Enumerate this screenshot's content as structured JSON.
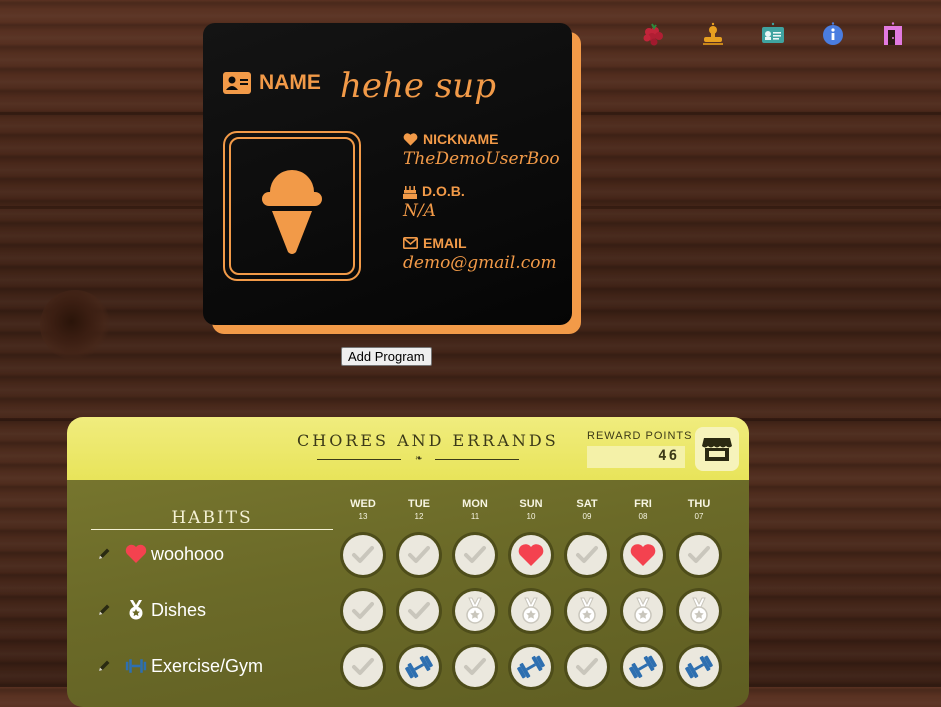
{
  "toolbar": {
    "icons": [
      "raspberry-icon",
      "stamp-icon",
      "id-card-icon",
      "info-icon",
      "exit-door-icon"
    ],
    "colors": [
      "#c2243a",
      "#e8a020",
      "#3fa3a0",
      "#4a7de0",
      "#e27ae0"
    ]
  },
  "profile": {
    "name_label": "NAME",
    "name_value": "hehe sup",
    "nickname_label": "NICKNAME",
    "nickname_value": "TheDemoUserBoo",
    "dob_label": "D.O.B.",
    "dob_value": "N/A",
    "email_label": "EMAIL",
    "email_value": "demo@gmail.com",
    "accent_color": "#f29a48"
  },
  "add_program_label": "Add Program",
  "chores": {
    "title": "CHORES AND ERRANDS",
    "reward_points_label": "REWARD POINTS",
    "reward_points_value": "46",
    "habits_title": "HABITS",
    "days": [
      {
        "day": "WED",
        "date": "13"
      },
      {
        "day": "TUE",
        "date": "12"
      },
      {
        "day": "MON",
        "date": "11"
      },
      {
        "day": "SUN",
        "date": "10"
      },
      {
        "day": "SAT",
        "date": "09"
      },
      {
        "day": "FRI",
        "date": "08"
      },
      {
        "day": "THU",
        "date": "07"
      }
    ],
    "habits": [
      {
        "name": "woohooo",
        "icon": "heart-icon",
        "cells": [
          "check",
          "check",
          "check",
          "heart",
          "check",
          "heart",
          "check"
        ]
      },
      {
        "name": "Dishes",
        "icon": "medal-icon",
        "cells": [
          "check",
          "check",
          "medal",
          "medal",
          "medal",
          "medal",
          "medal"
        ]
      },
      {
        "name": "Exercise/Gym",
        "icon": "dumbbell-icon",
        "cells": [
          "check",
          "dumbbell",
          "check",
          "dumbbell",
          "check",
          "dumbbell",
          "dumbbell"
        ]
      }
    ]
  }
}
